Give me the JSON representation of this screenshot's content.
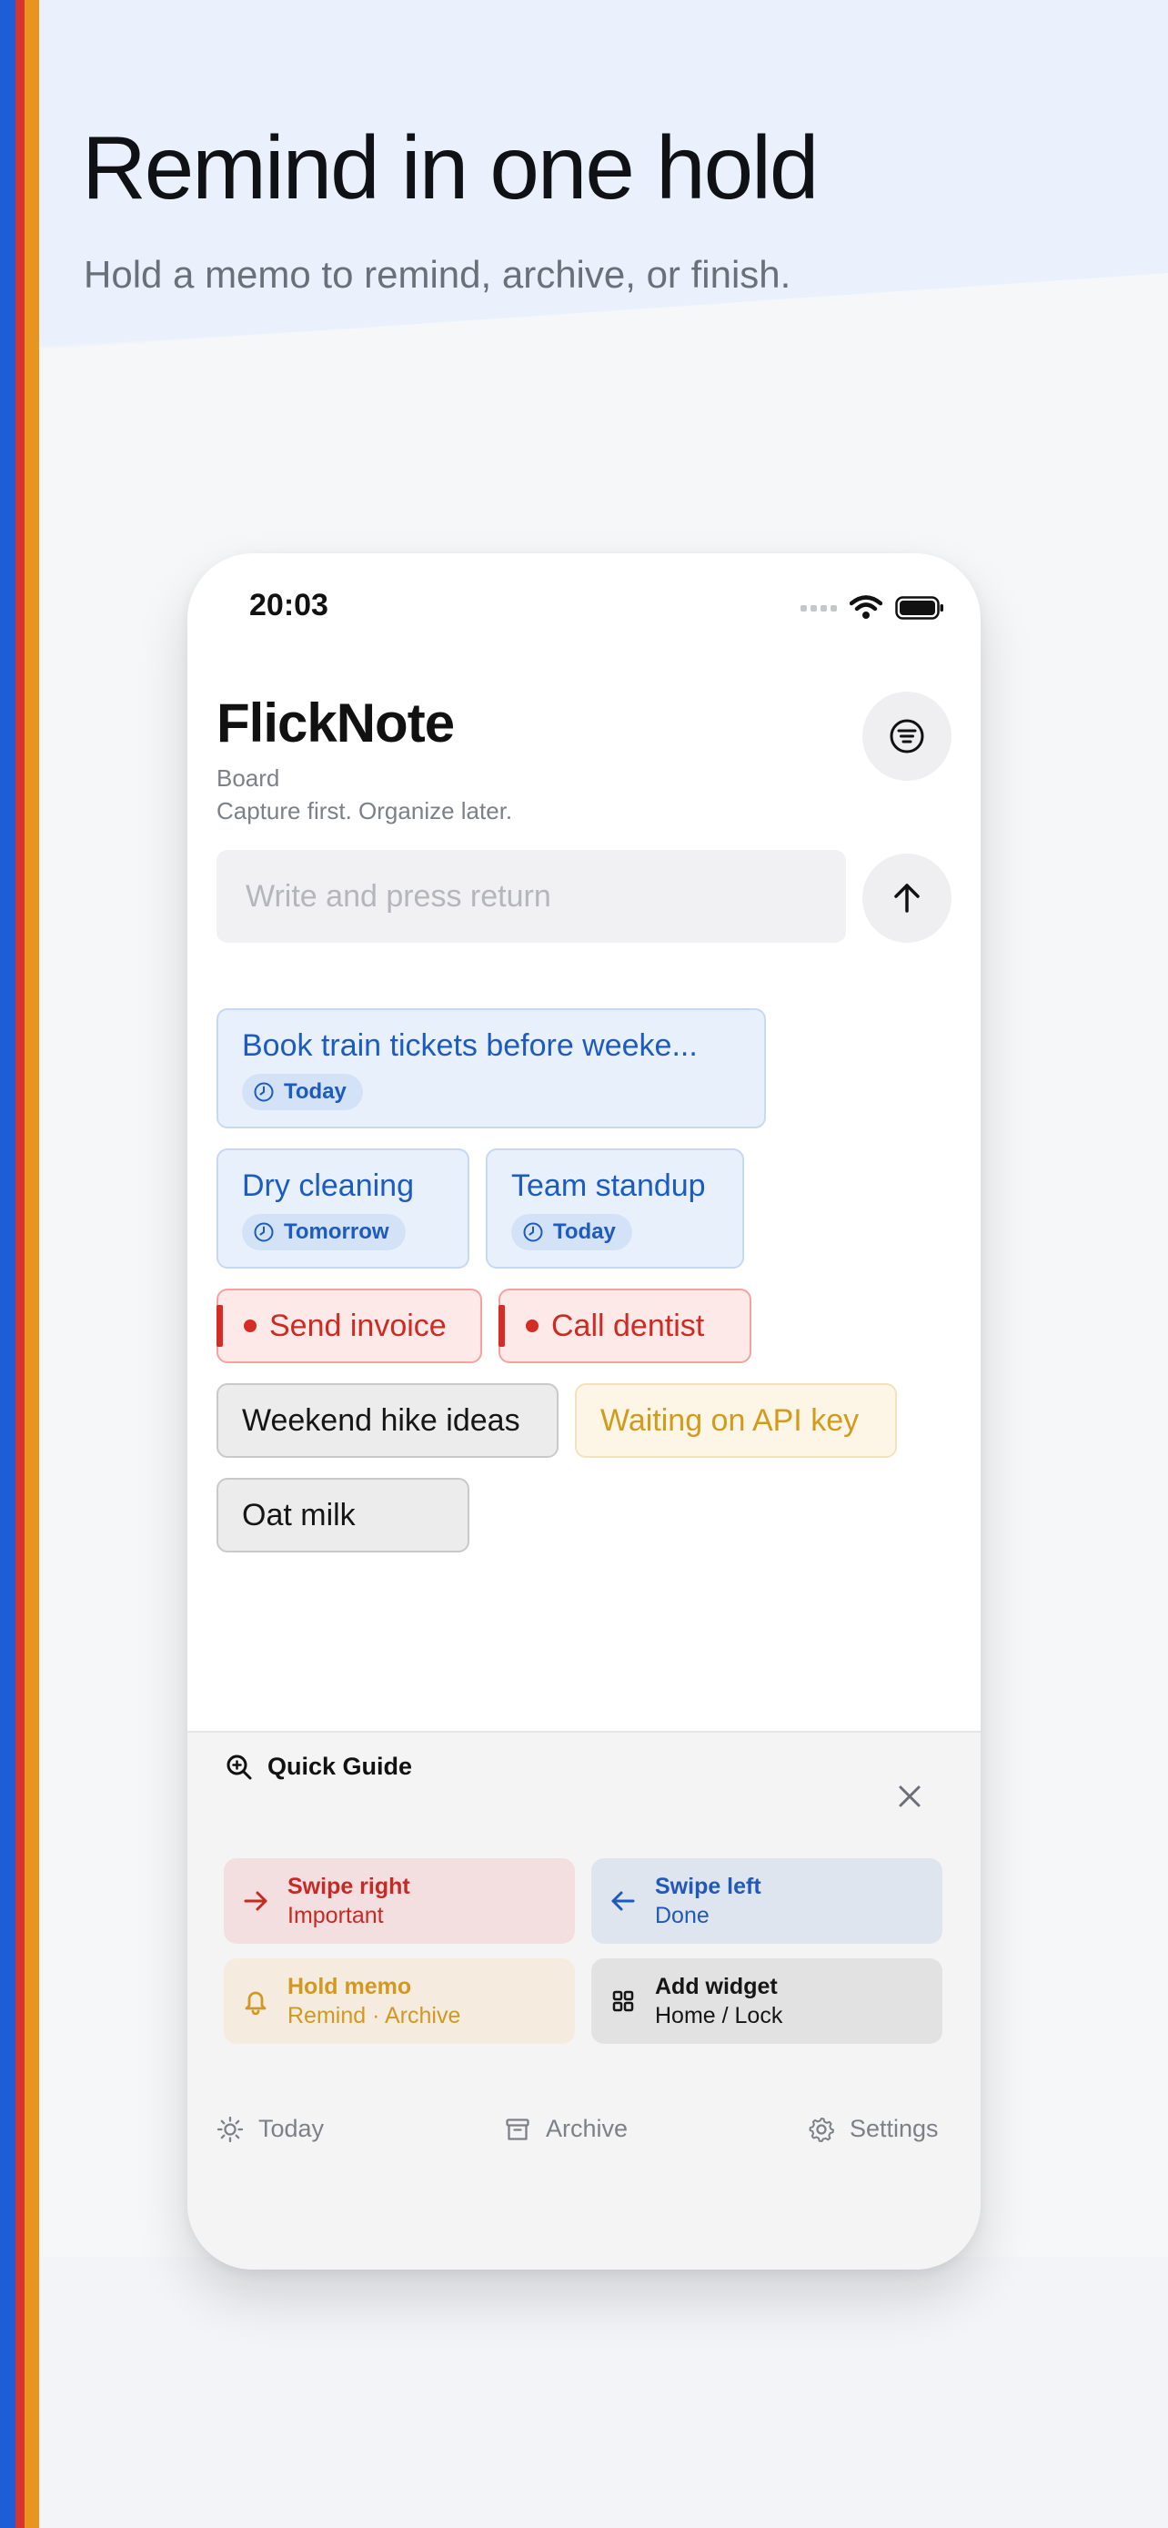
{
  "headline": "Remind in one hold",
  "subline": "Hold a memo to remind, archive, or finish.",
  "colors": {
    "accent_blue": "#1d5ed6",
    "accent_red": "#d9332e",
    "accent_orange": "#e8951f"
  },
  "status_bar": {
    "time": "20:03",
    "icons": [
      "signal-icon",
      "wifi-icon",
      "battery-icon"
    ]
  },
  "app": {
    "title": "FlickNote",
    "view": "Board",
    "tagline": "Capture first. Organize later.",
    "input_placeholder": "Write and press return",
    "input_value": ""
  },
  "memos": {
    "book_train": {
      "text": "Book train tickets before weeke...",
      "badge": "Today"
    },
    "dry_cleaning": {
      "text": "Dry cleaning",
      "badge": "Tomorrow"
    },
    "team_standup": {
      "text": "Team standup",
      "badge": "Today"
    },
    "send_invoice": {
      "text": "Send invoice"
    },
    "call_dentist": {
      "text": "Call dentist"
    },
    "weekend_hike": {
      "text": "Weekend hike ideas"
    },
    "waiting_api": {
      "text": "Waiting on API key"
    },
    "oat_milk": {
      "text": "Oat milk"
    }
  },
  "guide": {
    "title": "Quick Guide",
    "tiles": [
      {
        "title": "Swipe right",
        "desc": "Important",
        "icon": "arrow-right-icon"
      },
      {
        "title": "Swipe left",
        "desc": "Done",
        "icon": "arrow-left-icon"
      },
      {
        "title": "Hold memo",
        "desc": "Remind · Archive",
        "icon": "bell-icon"
      },
      {
        "title": "Add widget",
        "desc": "Home / Lock",
        "icon": "grid-icon"
      }
    ]
  },
  "tabs": [
    {
      "label": "Today",
      "icon": "sun-icon"
    },
    {
      "label": "Archive",
      "icon": "archive-icon"
    },
    {
      "label": "Settings",
      "icon": "gear-icon"
    }
  ]
}
